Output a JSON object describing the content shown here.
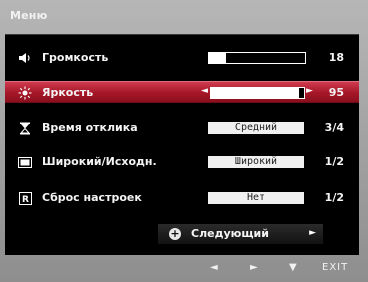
{
  "menu": {
    "title": "Меню",
    "items": [
      {
        "icon": "speaker-icon",
        "label": "Громкость",
        "value": "18",
        "level": 0.18,
        "selected": false
      },
      {
        "icon": "brightness-icon",
        "label": "Яркость",
        "value": "95",
        "level": 0.95,
        "selected": true
      },
      {
        "icon": "hourglass-icon",
        "label": "Время отклика",
        "option": "Средний",
        "value": "3/4",
        "selected": false
      },
      {
        "icon": "widescreen-icon",
        "label": "Широкий/Исходн.",
        "option": "Широкий",
        "value": "1/2",
        "selected": false
      },
      {
        "icon": "reset-icon",
        "label": "Сброс настроек",
        "option": "Нет",
        "value": "1/2",
        "selected": false
      }
    ],
    "next_label": "Следующий"
  },
  "footer": {
    "left": "◄",
    "right": "►",
    "down": "▼",
    "exit": "EXIT"
  },
  "colors": {
    "selected_row": "#a51728",
    "panel_bg": "#000000",
    "bezel": "#9a9a9a"
  }
}
